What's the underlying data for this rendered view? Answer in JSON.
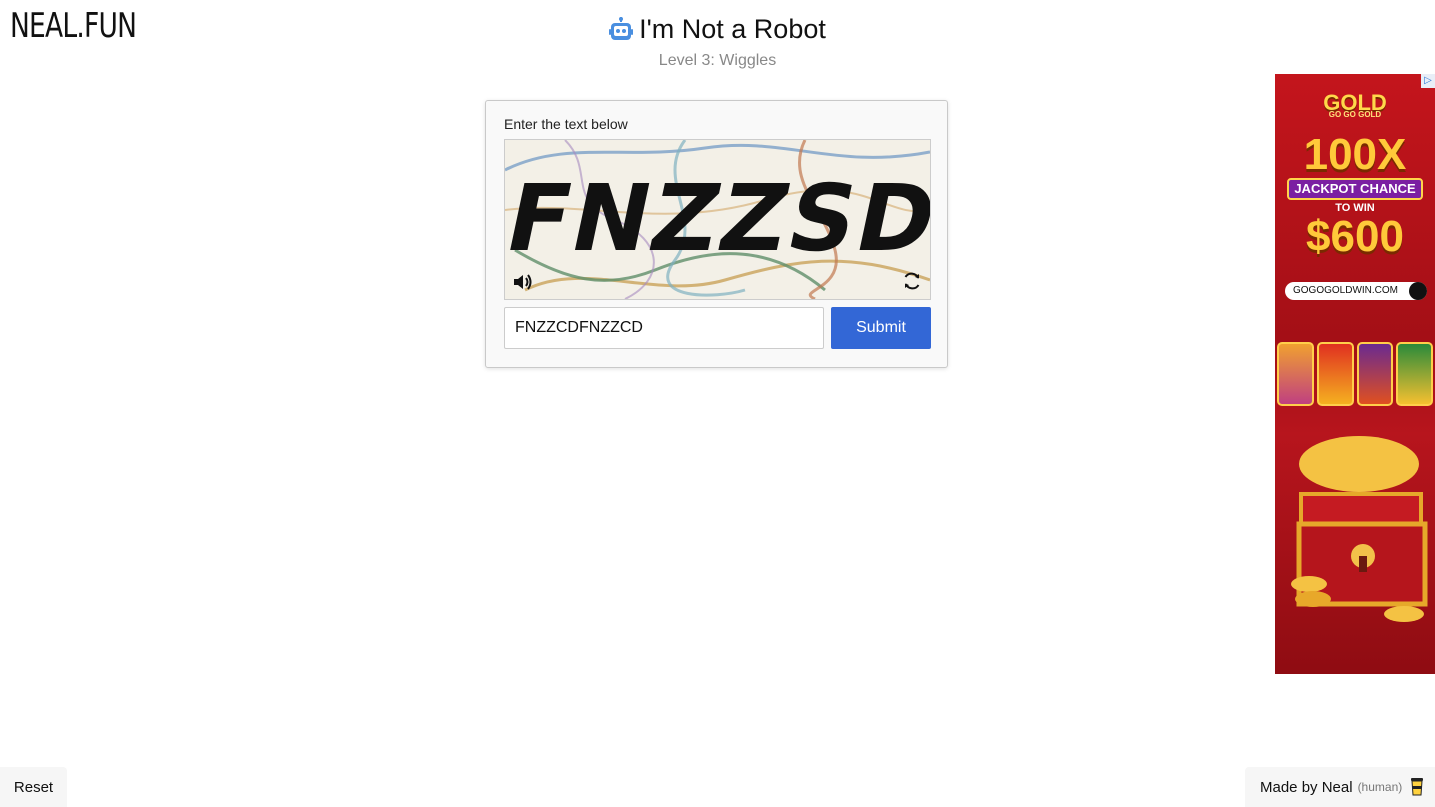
{
  "header": {
    "logo_text": "NEAL.FUN",
    "title": "I'm Not a Robot",
    "title_icon": "robot-icon",
    "subtitle": "Level 3: Wiggles"
  },
  "captcha": {
    "prompt": "Enter the text below",
    "image_text": "FNZZSD",
    "audio_icon": "speaker-icon",
    "refresh_icon": "refresh-icon",
    "input_value": "FNZZCDFNZZCD",
    "submit_label": "Submit"
  },
  "ad": {
    "brand": "GOLD",
    "brand_sub": "GO GO GOLD",
    "multiplier": "100X",
    "jackpot_text": "JACKPOT CHANCE",
    "to_win_text": "TO WIN",
    "prize": "$600",
    "url": "GOGOGOLDWIN.COM"
  },
  "footer": {
    "reset_label": "Reset",
    "credit_text": "Made by Neal",
    "credit_note": "(human)",
    "credit_icon": "coffee-cup-icon"
  },
  "colors": {
    "accent": "#3367d6",
    "robot_icon": "#4a8fe0",
    "subtitle": "#888888"
  }
}
